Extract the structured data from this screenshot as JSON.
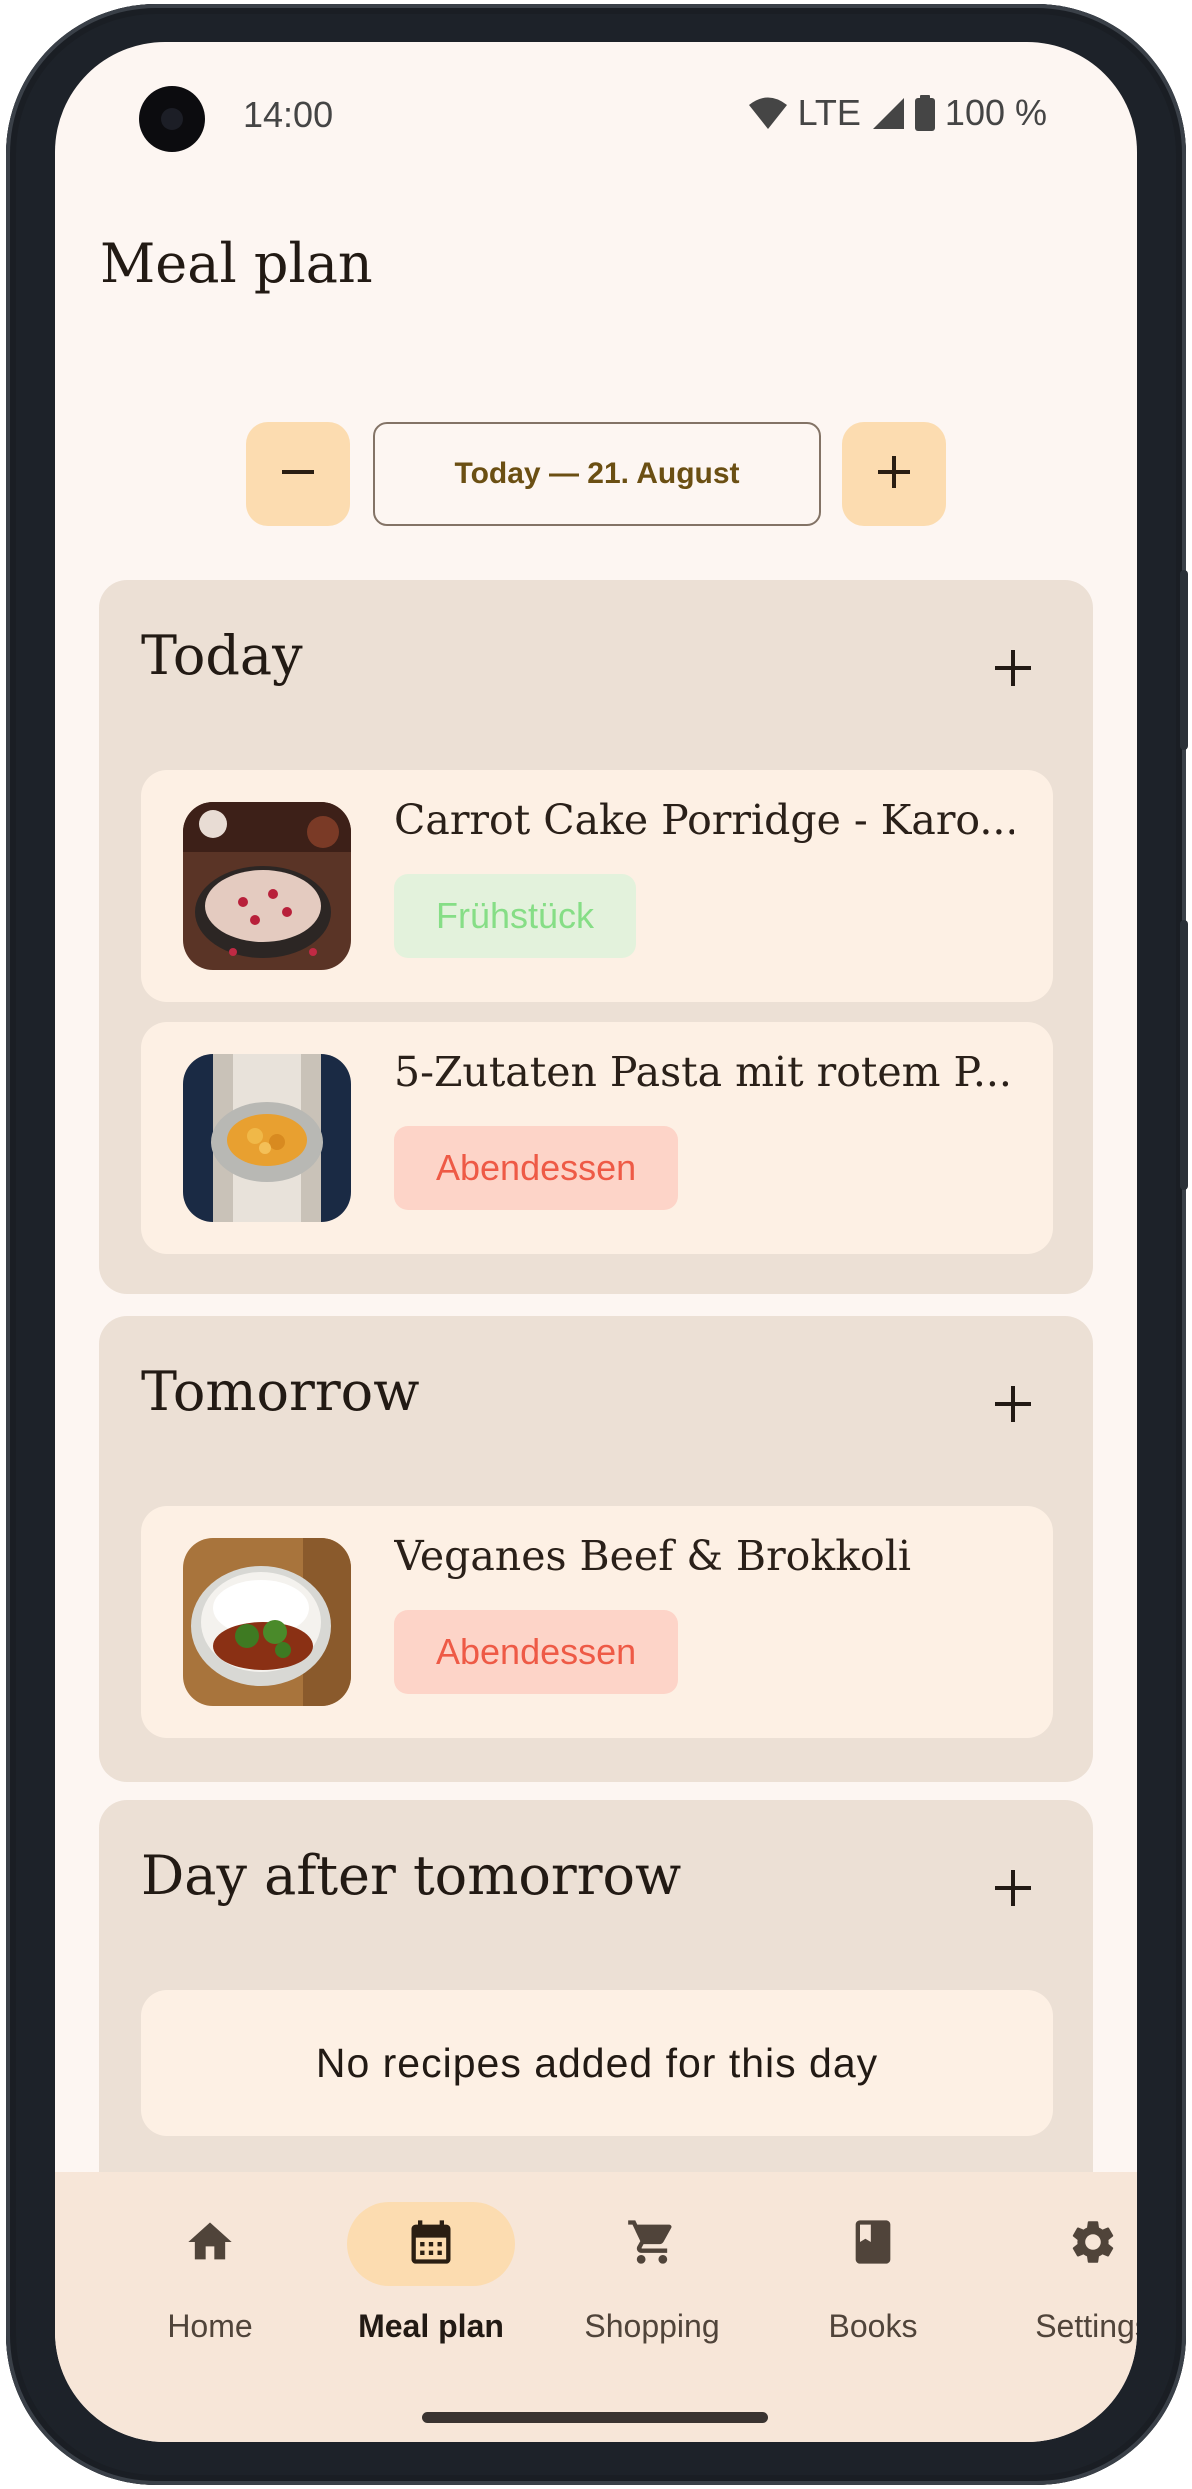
{
  "status_bar": {
    "time": "14:00",
    "network": "LTE",
    "battery": "100 %"
  },
  "page": {
    "title": "Meal plan"
  },
  "date_selector": {
    "label": "Today — 21. August"
  },
  "days": [
    {
      "title": "Today",
      "recipes": [
        {
          "title": "Carrot Cake Porridge - Karo...",
          "tag": "Frühstück"
        },
        {
          "title": "5-Zutaten Pasta mit rotem P...",
          "tag": "Abendessen"
        }
      ]
    },
    {
      "title": "Tomorrow",
      "recipes": [
        {
          "title": "Veganes Beef & Brokkoli",
          "tag": "Abendessen"
        }
      ]
    },
    {
      "title": "Day after tomorrow",
      "empty_text": "No recipes added for this day"
    }
  ],
  "nav": {
    "items": [
      {
        "label": "Home",
        "icon": "home-icon"
      },
      {
        "label": "Meal plan",
        "icon": "calendar-icon",
        "active": true
      },
      {
        "label": "Shopping",
        "icon": "cart-icon"
      },
      {
        "label": "Books",
        "icon": "book-icon"
      },
      {
        "label": "Settings",
        "icon": "gear-icon"
      }
    ]
  },
  "colors": {
    "background": "#fdf6f2",
    "card": "#ece0d5",
    "item": "#fdf0e4",
    "accent": "#fcdcb0",
    "breakfast_tag_bg": "#e3f2dc",
    "breakfast_tag_text": "#86de86",
    "dinner_tag_bg": "#fdd4c8",
    "dinner_tag_text": "#ee5a46"
  }
}
